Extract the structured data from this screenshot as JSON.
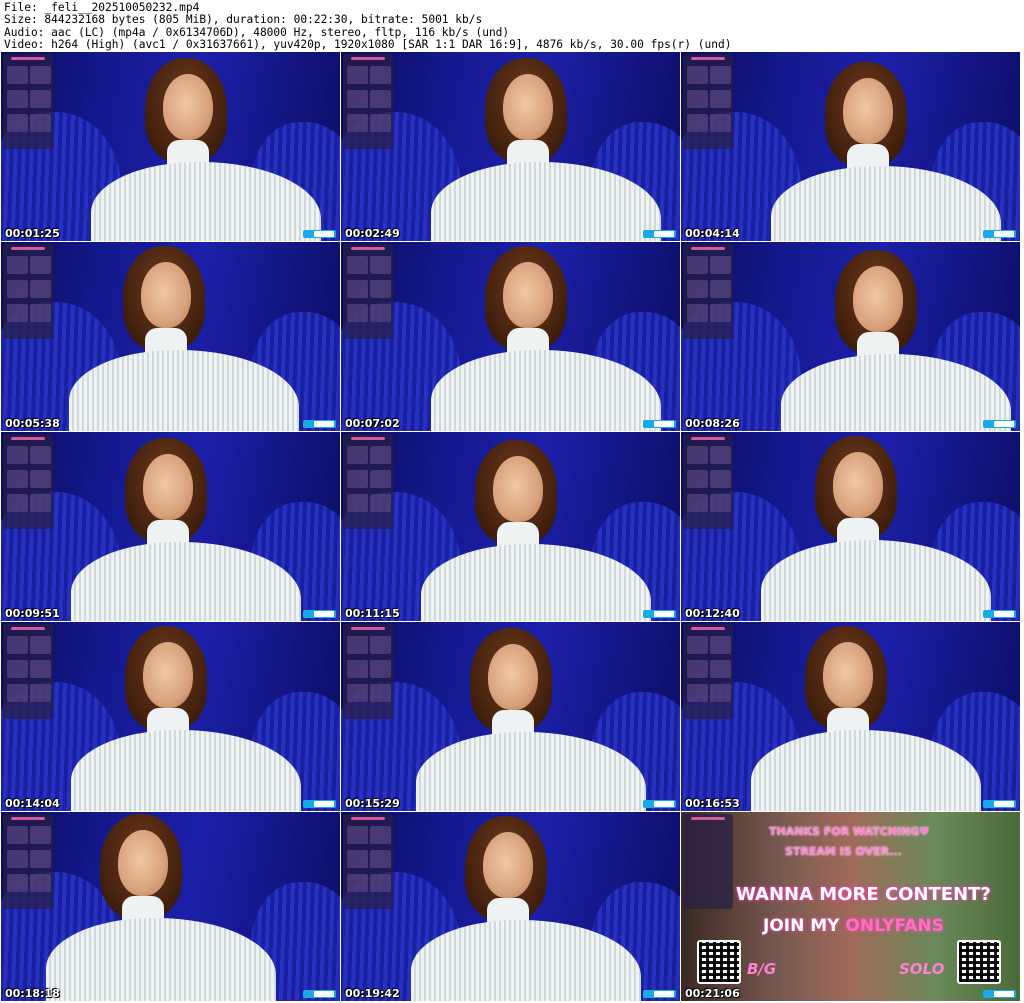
{
  "header": {
    "line1": "File: _feli__202510050232.mp4",
    "line2": "Size: 844232168 bytes (805 MiB), duration: 00:22:30, bitrate: 5001 kb/s",
    "line3": "Audio: aac (LC) (mp4a / 0x6134706D), 48000 Hz, stereo, fltp, 116 kb/s (und)",
    "line4": "Video: h264 (High) (avc1 / 0x31637661), yuv420p, 1920x1080 [SAR 1:1 DAR 16:9], 4876 kb/s, 30.00 fps(r) (und)"
  },
  "thumbnails": [
    {
      "timestamp": "00:01:25"
    },
    {
      "timestamp": "00:02:49"
    },
    {
      "timestamp": "00:04:14"
    },
    {
      "timestamp": "00:05:38"
    },
    {
      "timestamp": "00:07:02"
    },
    {
      "timestamp": "00:08:26"
    },
    {
      "timestamp": "00:09:51"
    },
    {
      "timestamp": "00:11:15"
    },
    {
      "timestamp": "00:12:40"
    },
    {
      "timestamp": "00:14:04"
    },
    {
      "timestamp": "00:15:29"
    },
    {
      "timestamp": "00:16:53"
    },
    {
      "timestamp": "00:18:18"
    },
    {
      "timestamp": "00:19:42"
    },
    {
      "timestamp": "00:21:06"
    }
  ],
  "promo": {
    "line1": "THANKS FOR WATCHING♥",
    "line2": "STREAM IS OVER...",
    "line3": "WANNA MORE CONTENT?",
    "line4_prefix": "JOIN MY ",
    "line4_brand": "ONLYFANS",
    "left_tag": "B/G",
    "right_tag": "SOLO"
  }
}
